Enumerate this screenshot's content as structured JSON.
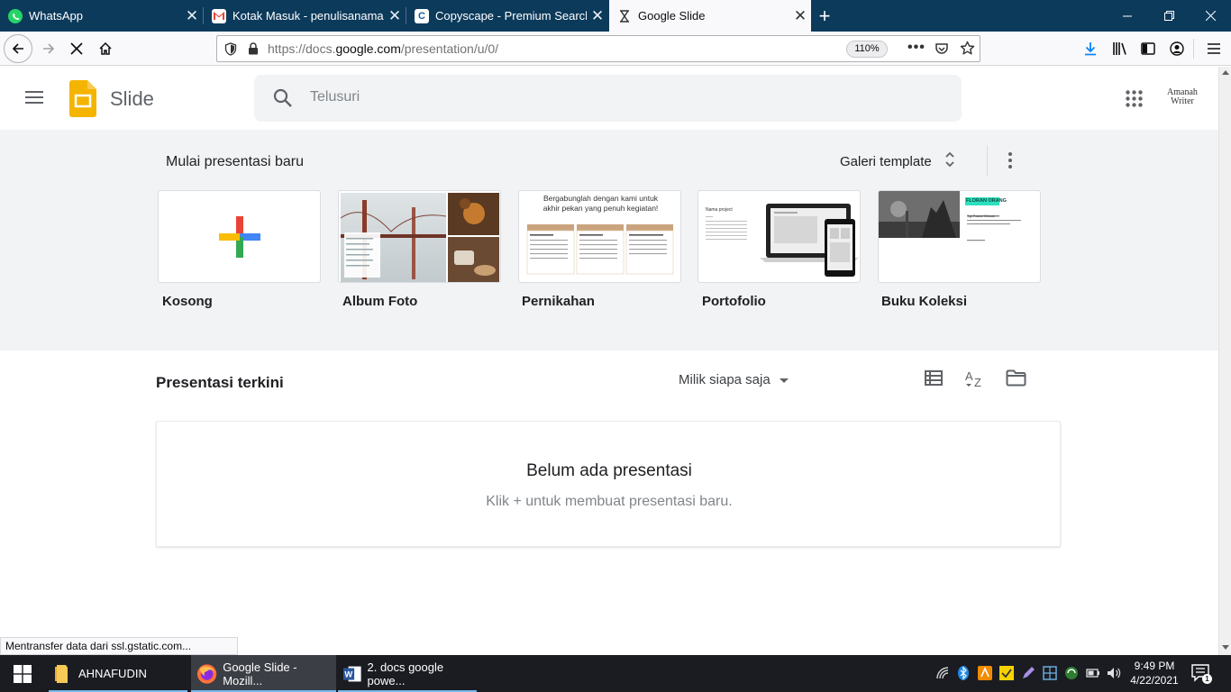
{
  "browser": {
    "tabs": [
      {
        "title": "WhatsApp",
        "icon": "whatsapp-icon",
        "active": false
      },
      {
        "title": "Kotak Masuk - penulisanamanah",
        "icon": "gmail-icon",
        "active": false
      },
      {
        "title": "Copyscape - Premium Search",
        "icon": "copyscape-icon",
        "active": false
      },
      {
        "title": "Google Slide",
        "icon": "hourglass-icon",
        "active": true
      }
    ],
    "url_prefix": "https://docs.",
    "url_domain": "google.com",
    "url_path": "/presentation/u/0/",
    "zoom": "110%"
  },
  "app": {
    "name": "Slide",
    "search_placeholder": "Telusuri",
    "account_label_1": "Amanah",
    "account_label_2": "Writer"
  },
  "gallery": {
    "heading": "Mulai presentasi baru",
    "gallery_button": "Galeri template",
    "templates": [
      {
        "label": "Kosong"
      },
      {
        "label": "Album Foto"
      },
      {
        "label": "Pernikahan"
      },
      {
        "label": "Portofolio"
      },
      {
        "label": "Buku Koleksi"
      }
    ],
    "wedding_line1": "Bergabunglah dengan kami untuk",
    "wedding_line2": "akhir pekan yang penuh kegiatan!",
    "portfolio_title": "Nama project",
    "collection_tag": "FLORAN ORANG",
    "collection_sub": "Tgl Pastel Sibuan"
  },
  "recent": {
    "heading": "Presentasi terkini",
    "owner_filter": "Milik siapa saja",
    "empty_title": "Belum ada presentasi",
    "empty_hint": "Klik + untuk membuat presentasi baru."
  },
  "status": {
    "text": "Mentransfer data dari ssl.gstatic.com..."
  },
  "taskbar": {
    "items": [
      {
        "label": "AHNAFUDIN",
        "icon": "folder-icon"
      },
      {
        "label": "Google Slide - Mozill...",
        "icon": "firefox-icon"
      },
      {
        "label": "2. docs google powe...",
        "icon": "word-icon"
      }
    ],
    "time": "9:49 PM",
    "date": "4/22/2021",
    "notifications": "1"
  },
  "colors": {
    "tabstrip": "#0c3a5b",
    "slides_yellow": "#f4b400",
    "gallery_bg": "#f1f3f4",
    "taskbar": "#1a1c22"
  }
}
